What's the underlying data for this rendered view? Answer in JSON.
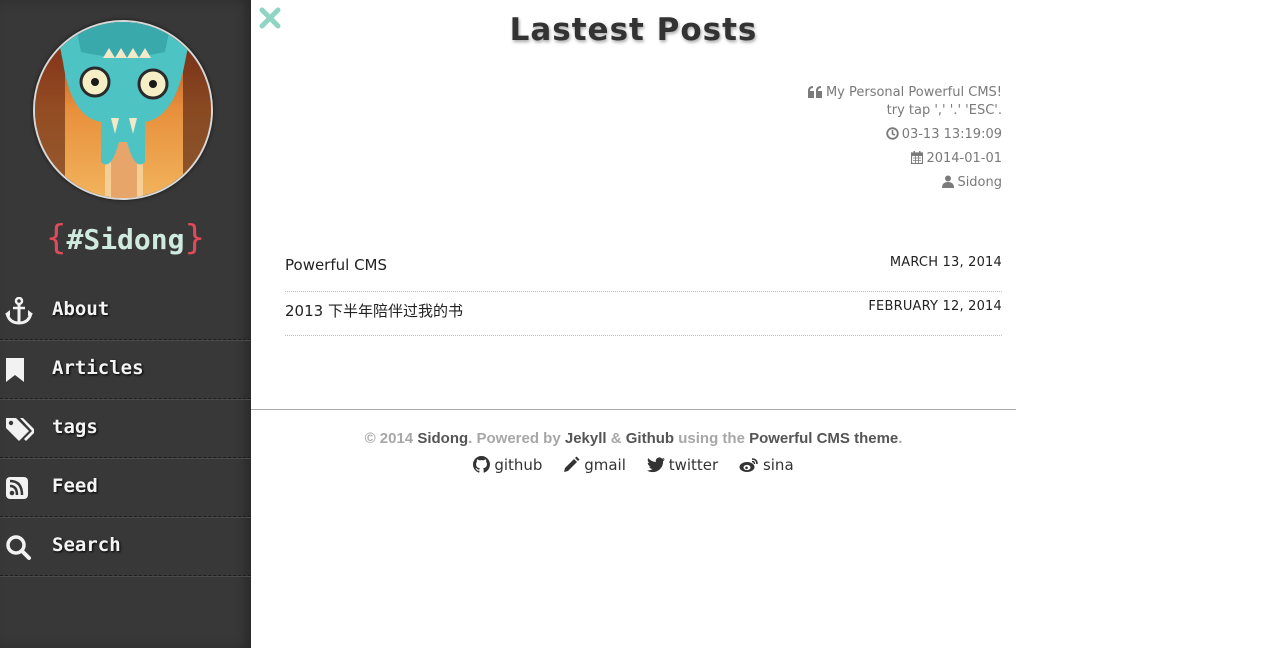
{
  "sidebar": {
    "brand": {
      "open": "{",
      "name": "#Sidong",
      "close": "}"
    },
    "nav": [
      {
        "label": "About",
        "icon": "anchor-icon"
      },
      {
        "label": "Articles",
        "icon": "bookmark-icon"
      },
      {
        "label": "tags",
        "icon": "tags-icon"
      },
      {
        "label": "Feed",
        "icon": "rss-icon"
      },
      {
        "label": "Search",
        "icon": "search-icon"
      }
    ]
  },
  "main": {
    "close_icon": "close-icon",
    "title": "Lastest Posts",
    "meta": {
      "quote_line1": "My Personal Powerful CMS!",
      "quote_line2": "try tap ',' '.' 'ESC'.",
      "updated": "03-13 13:19:09",
      "date": "2014-01-01",
      "author": "Sidong"
    },
    "posts": [
      {
        "title": "Powerful CMS",
        "date": "MARCH 13, 2014"
      },
      {
        "title": "2013 下半年陪伴过我的书",
        "date": "FEBRUARY 12, 2014"
      }
    ]
  },
  "footer": {
    "copyright": "© 2014 ",
    "owner": "Sidong",
    "powered_by": ". Powered by ",
    "jekyll": "Jekyll",
    "amp": " & ",
    "github": "Github",
    "using_the": " using the ",
    "theme": "Powerful CMS theme",
    "period": ".",
    "social": [
      {
        "label": "github",
        "icon": "github-icon"
      },
      {
        "label": "gmail",
        "icon": "pencil-icon"
      },
      {
        "label": "twitter",
        "icon": "twitter-icon"
      },
      {
        "label": "sina",
        "icon": "weibo-icon"
      }
    ]
  },
  "colors": {
    "sidebar_bg": "#383838",
    "accent_red": "#e14a5a",
    "accent_teal": "#9fd9c6",
    "close_icon": "#8fd5c3"
  }
}
